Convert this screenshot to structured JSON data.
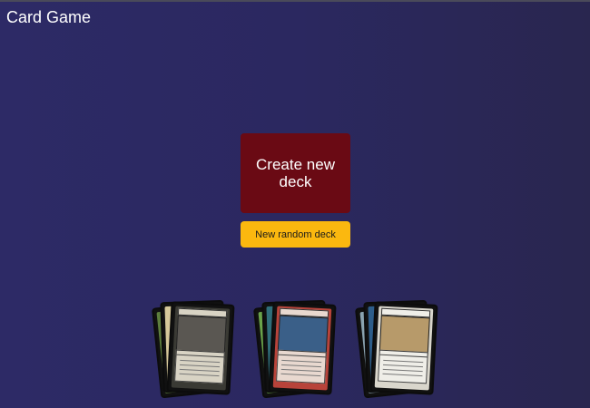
{
  "app": {
    "title": "Card Game"
  },
  "actions": {
    "create_label": "Create new deck",
    "random_label": "New random deck"
  },
  "decks": [
    {
      "name": "black-deck",
      "theme": "black",
      "colors": {
        "frame": "#3a3a34",
        "art": "#5a5752",
        "text": "#d8d3c4",
        "back1": "#d6c89a",
        "back2": "#5d7e3d"
      }
    },
    {
      "name": "red-deck",
      "theme": "red",
      "colors": {
        "frame": "#b8433a",
        "art": "#3a5f88",
        "text": "#e8d8cf",
        "back1": "#2f6e7a",
        "back2": "#6aa34a"
      }
    },
    {
      "name": "white-deck",
      "theme": "white",
      "colors": {
        "frame": "#d9d6cc",
        "art": "#b79a6a",
        "text": "#efeee8",
        "back1": "#2d5d8a",
        "back2": "#8aa3b0"
      }
    }
  ]
}
